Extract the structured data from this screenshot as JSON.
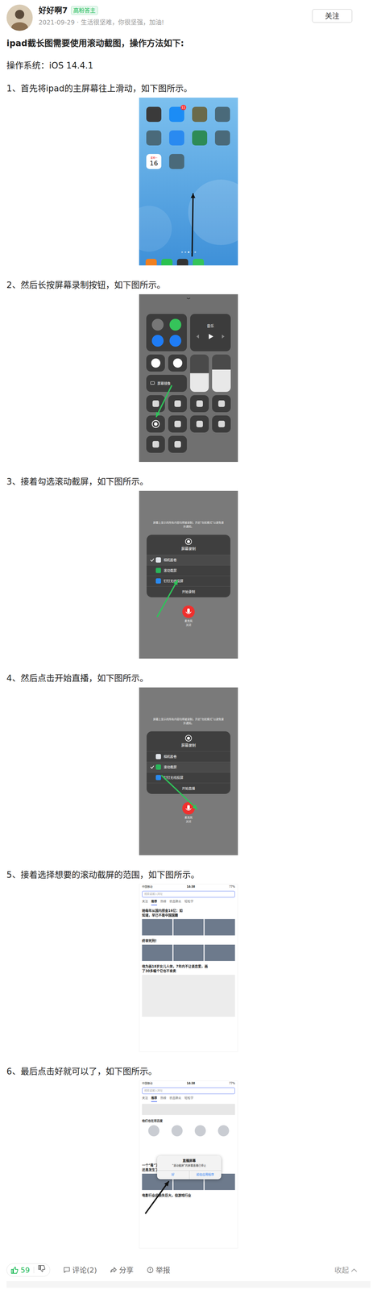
{
  "author": {
    "name": "好好啊7",
    "badge": "高粉答主",
    "meta": "2021-09-29 · 生活很坚难，你很坚强，加油!",
    "follow": "关注"
  },
  "title": "ipad截长图需要使用滚动截图，操作方法如下:",
  "os": "操作系统：iOS 14.4.1",
  "steps": [
    {
      "text": "1、首先将ipad的主屏幕往上滑动，如下图所示。",
      "kind": "home",
      "shot": {
        "badge": "11",
        "calendar": {
          "weekday": "星期一",
          "day": "16"
        }
      }
    },
    {
      "text": "2、然后长按屏幕录制按钮，如下图所示。",
      "kind": "control",
      "shot": {
        "music": "音乐",
        "mirror": "屏幕镜像",
        "brightness": 0.5,
        "volume": 0.6
      }
    },
    {
      "text": "3、接着勾选滚动截屏，如下图所示。",
      "kind": "picker",
      "shot": {
        "note": "屏幕上显示的所有内容均将被录制，开启“勿扰模式”以避免意外通知。",
        "heading": "屏幕录制",
        "options": [
          {
            "label": "相机胶卷",
            "selected": true
          },
          {
            "label": "滚动截屏",
            "selected": false
          },
          {
            "label": "钉钉无线投屏",
            "selected": false
          }
        ],
        "action": "开始录制",
        "mic": "麦克风",
        "mic_state": "关闭"
      }
    },
    {
      "text": "4、然后点击开始直播，如下图所示。",
      "kind": "picker",
      "shot": {
        "note": "屏幕上显示的所有内容均将被录制，开启“勿扰模式”以避免意外通知。",
        "heading": "屏幕录制",
        "options": [
          {
            "label": "相机胶卷",
            "selected": false
          },
          {
            "label": "滚动截屏",
            "selected": true
          },
          {
            "label": "钉钉无线投屏",
            "selected": false
          }
        ],
        "action": "开始直播",
        "mic": "麦克风",
        "mic_state": "关闭"
      }
    },
    {
      "text": "5、接着选择想要的滚动截屏的范围，如下图所示。",
      "kind": "feed",
      "shot": {
        "carrier": "中国移动",
        "time": "14:38",
        "battery": "77%",
        "search": "搜索或输入网址",
        "tabs": [
          {
            "label": "关注",
            "selected": false
          },
          {
            "label": "推荐",
            "selected": true
          },
          {
            "label": "热榜",
            "selected": false
          },
          {
            "label": "抗击肺炎",
            "selected": false
          },
          {
            "label": "轻松学",
            "selected": false
          }
        ],
        "items": [
          {
            "lines": [
              "她每年从国内捞金16亿：如",
              "知道，早已不是中国国籍"
            ],
            "kind": "triple"
          },
          {
            "lines": [
              "终审死刑!"
            ],
            "kind": "triple"
          },
          {
            "lines": [
              "他为画18岁女儿人体，7年内不让谈恋爱，画",
              "了30多幅个它也不肯卖"
            ],
            "kind": "big"
          }
        ]
      }
    },
    {
      "text": "6、最后点击好就可以了，如下图所示。",
      "kind": "dialog",
      "shot": {
        "carrier": "中国移动",
        "time": "14:38",
        "battery": "77%",
        "search": "搜索或输入网址",
        "tabs": [
          {
            "label": "关注",
            "selected": false
          },
          {
            "label": "推荐",
            "selected": true
          },
          {
            "label": "热榜",
            "selected": false
          },
          {
            "label": "抗击肺炎",
            "selected": false
          },
          {
            "label": "轻松学",
            "selected": false
          }
        ],
        "section": "他们也在用百度",
        "items": [
          {
            "lines": [
              "一个\"毒\"了10年的一座城！钟南山最担心的事",
              "还是发生了"
            ],
            "kind": "triple"
          },
          {
            "lines": [
              "电影行业迎损失巨大，但游戏行业"
            ],
            "kind": "plain"
          }
        ],
        "dialog": {
          "title": "直播屏幕",
          "body": "“滚动截屏”的屏幕直播已停止",
          "buttons": [
            "好",
            "前往应用程序"
          ]
        }
      }
    }
  ],
  "footer": {
    "likes": "59",
    "comments": "评论(2)",
    "share": "分享",
    "report": "举报",
    "collapse": "收起"
  }
}
